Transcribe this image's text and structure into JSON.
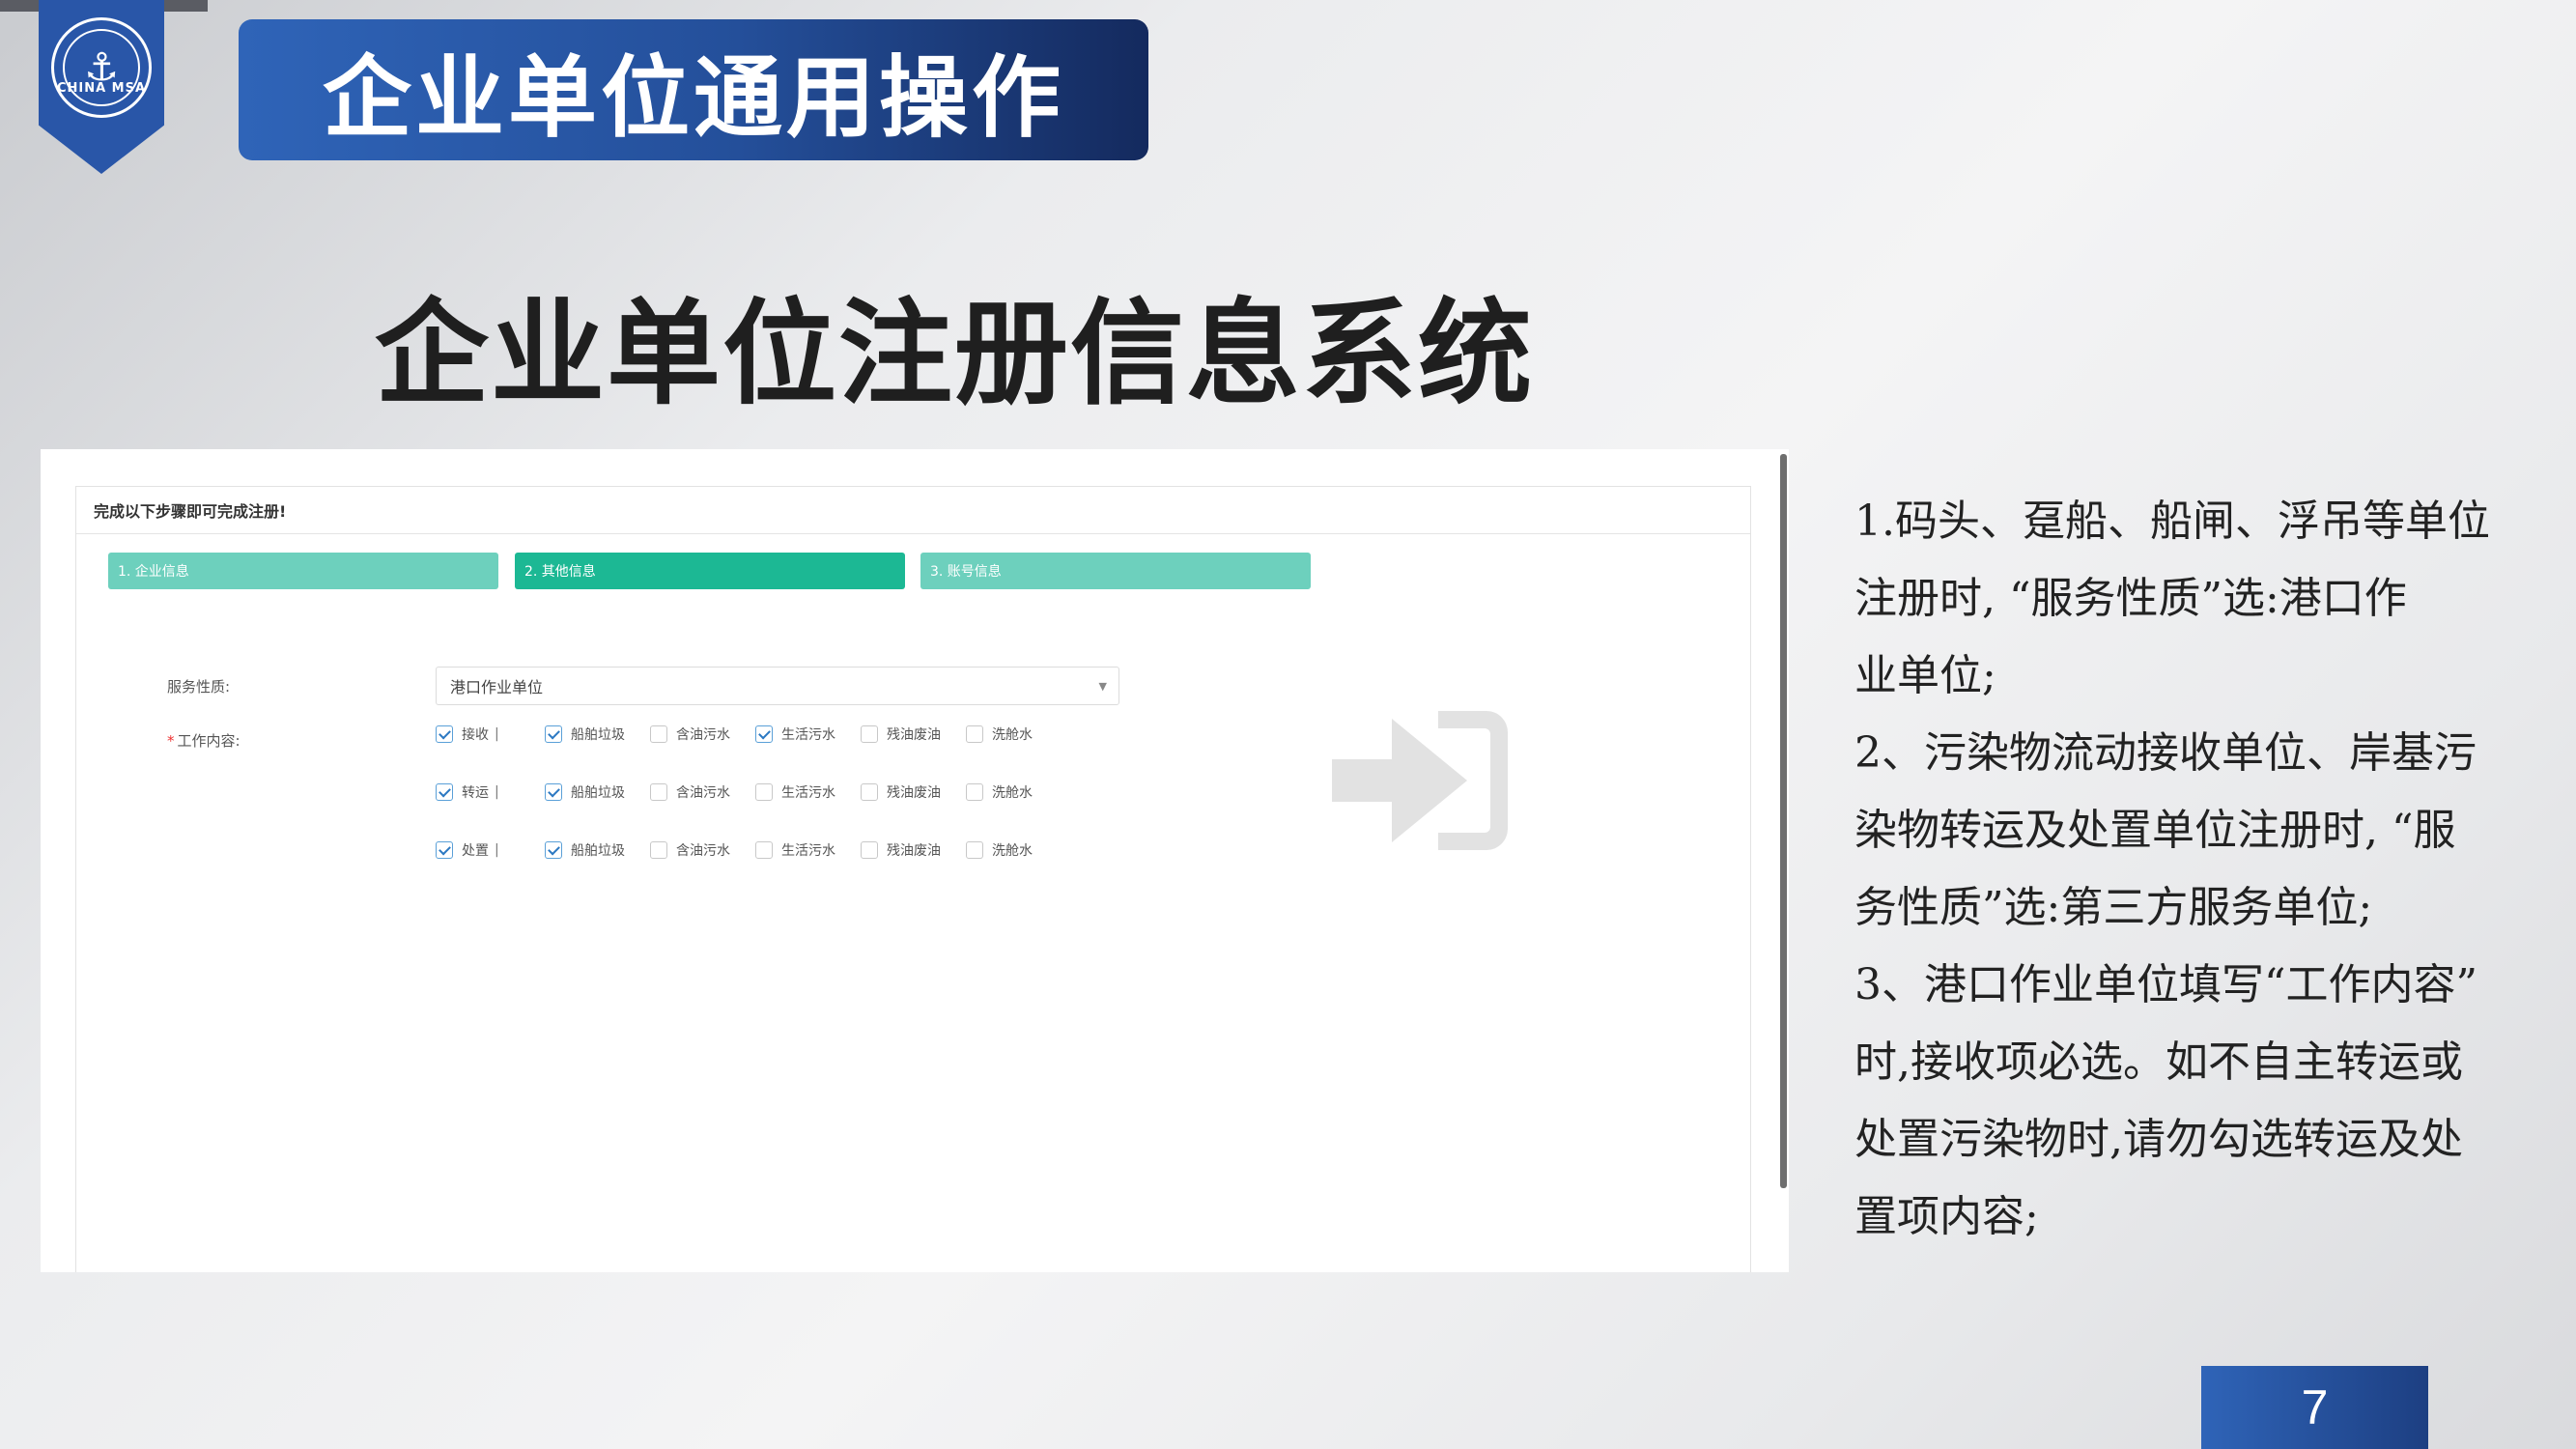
{
  "header": {
    "section_title": "企业单位通用操作",
    "emblem_text": "CHINA MSA",
    "emblem_icon": "anchor-icon"
  },
  "main_heading": "企业单位注册信息系统",
  "form": {
    "header_text": "完成以下步骤即可完成注册!",
    "steps": [
      {
        "label": "1. 企业信息",
        "state": "done"
      },
      {
        "label": "2. 其他信息",
        "state": "active"
      },
      {
        "label": "3. 账号信息",
        "state": "done"
      }
    ],
    "service_label": "服务性质:",
    "service_value": "港口作业单位",
    "work_label": "工作内容:",
    "rows": [
      {
        "name": "接收",
        "items": [
          {
            "label": "接收",
            "checked": true
          },
          {
            "label": "船舶垃圾",
            "checked": true
          },
          {
            "label": "含油污水",
            "checked": false
          },
          {
            "label": "生活污水",
            "checked": true
          },
          {
            "label": "残油废油",
            "checked": false
          },
          {
            "label": "洗舱水",
            "checked": false
          }
        ]
      },
      {
        "name": "转运",
        "items": [
          {
            "label": "转运",
            "checked": true
          },
          {
            "label": "船舶垃圾",
            "checked": true
          },
          {
            "label": "含油污水",
            "checked": false
          },
          {
            "label": "生活污水",
            "checked": false
          },
          {
            "label": "残油废油",
            "checked": false
          },
          {
            "label": "洗舱水",
            "checked": false
          }
        ]
      },
      {
        "name": "处置",
        "items": [
          {
            "label": "处置",
            "checked": true
          },
          {
            "label": "船舶垃圾",
            "checked": true
          },
          {
            "label": "含油污水",
            "checked": false
          },
          {
            "label": "生活污水",
            "checked": false
          },
          {
            "label": "残油废油",
            "checked": false
          },
          {
            "label": "洗舱水",
            "checked": false
          }
        ]
      }
    ],
    "overlay_icon": "login-arrow-icon"
  },
  "notes": {
    "line1": "1.码头、趸船、船闸、浮吊等单位",
    "line2": "注册时, “服务性质”选:港口作",
    "line3": "业单位;",
    "line4": "2、污染物流动接收单位、岸基污",
    "line5": "染物转运及处置单位注册时, “服",
    "line6": "务性质”选:第三方服务单位;",
    "line7": "3、港口作业单位填写“工作内容”",
    "line8": "时,接收项必选。如不自主转运或",
    "line9": "处置污染物时,请勿勾选转运及处",
    "line10": "置项内容;"
  },
  "page_number": "7",
  "colors": {
    "brand_blue": "#2956a8",
    "step_done": "#6dd0bd",
    "step_active": "#1cb894"
  }
}
